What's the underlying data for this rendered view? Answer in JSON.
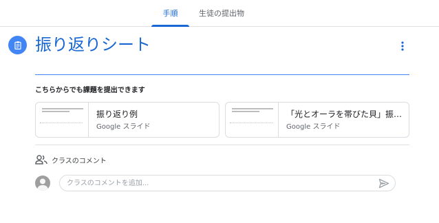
{
  "tabs": [
    {
      "label": "手順",
      "active": true
    },
    {
      "label": "生徒の提出物",
      "active": false
    }
  ],
  "assignment": {
    "title": "振り返りシート",
    "icon": "assignment-icon",
    "more_icon": "more-vert-icon"
  },
  "submission": {
    "heading": "こちらからでも課題を提出できます",
    "attachments": [
      {
        "title": "振り返り例",
        "type": "Google スライド"
      },
      {
        "title": "「光とオーラを帯びた貝」振…",
        "type": "Google スライド"
      }
    ]
  },
  "comments": {
    "label": "クラスのコメント",
    "icon": "people-icon",
    "placeholder": "クラスのコメントを追加...",
    "send_icon": "send-icon"
  },
  "colors": {
    "accent": "#1967d2",
    "icon_bg": "#4285f4",
    "divider": "#e0e0e0"
  }
}
